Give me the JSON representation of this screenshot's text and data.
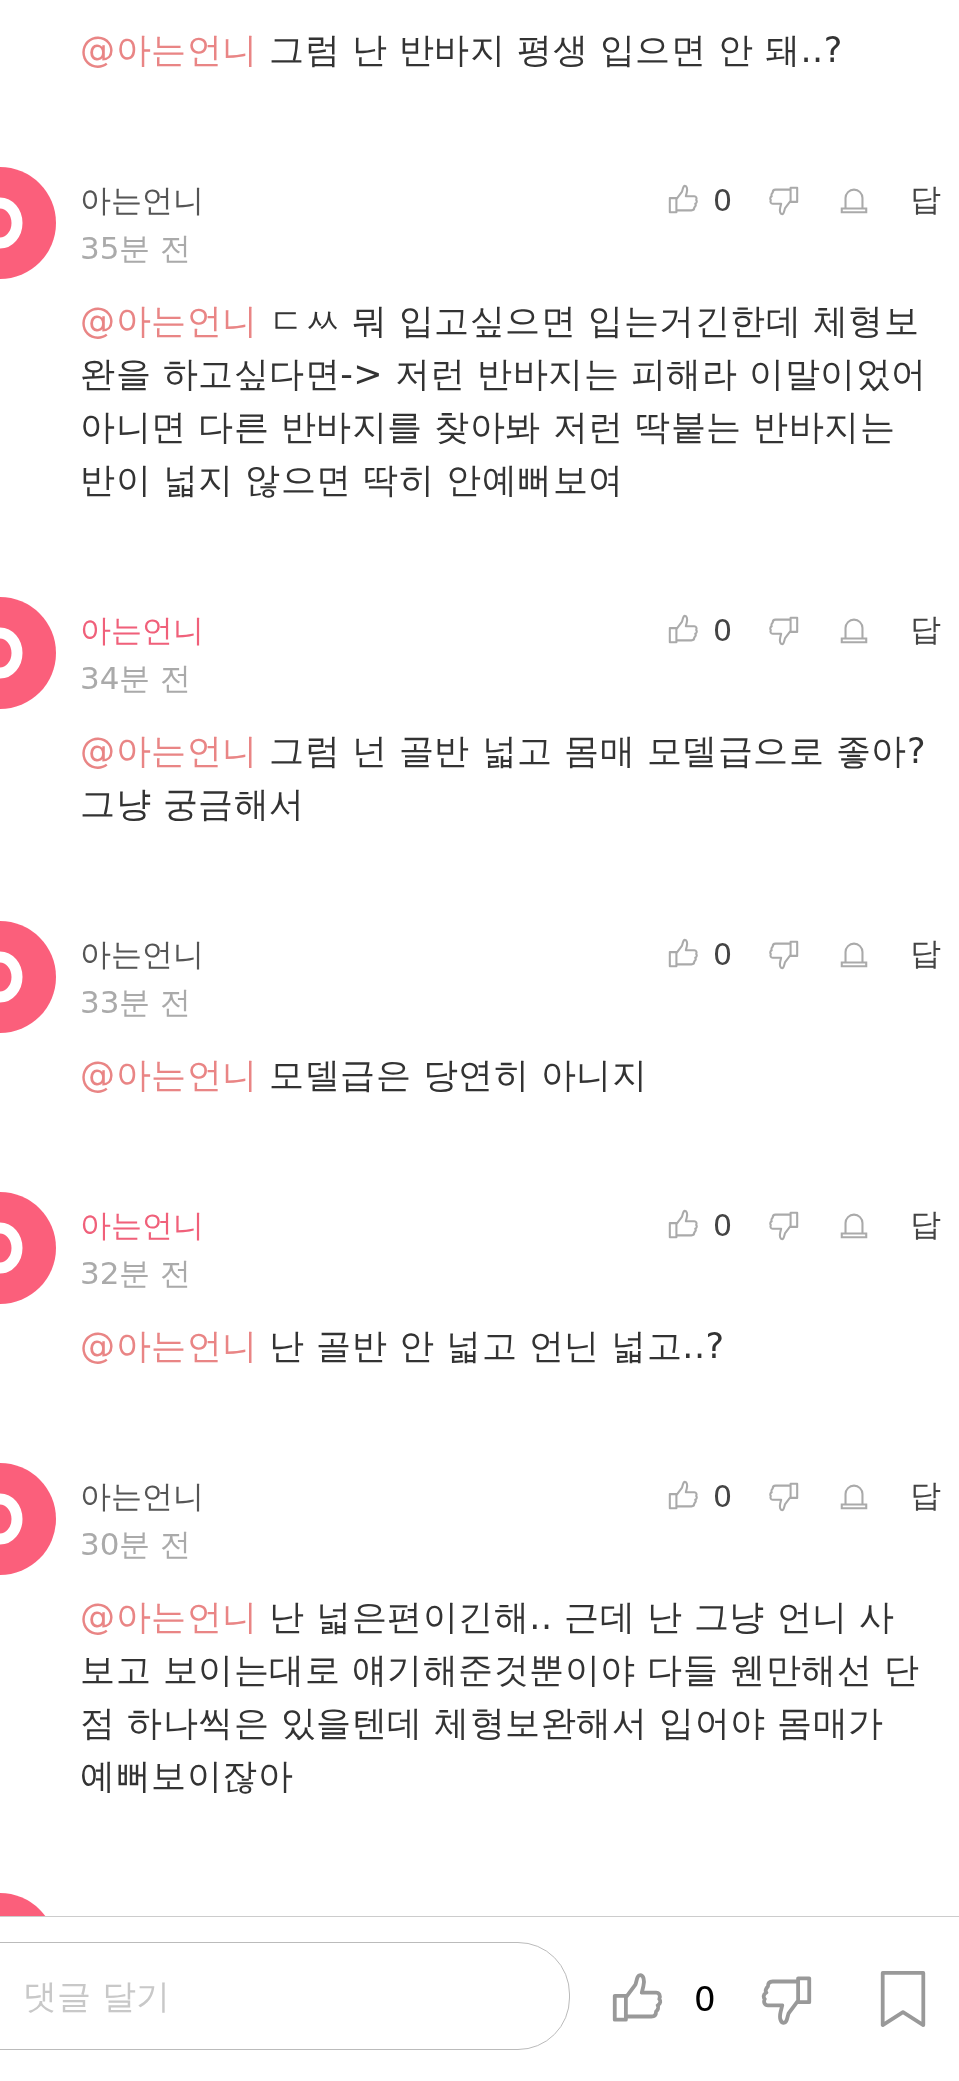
{
  "top_reply": {
    "mention": "@아는언니",
    "lines": [
      "그럼 난 반바지 평생 입으면 안 돼..?"
    ]
  },
  "comments": [
    {
      "author": "아는언니",
      "color": "#555555",
      "time": "35분 전",
      "likes": "0",
      "reply": "답",
      "mention": "@아는언니",
      "lines": [
        "ㄷㅆ 뭐 입고싶으면 입는거긴한데 체형보",
        "완을 하고싶다면-> 저런 반바지는 피해라 이말이었어",
        "아니면 다른 반바지를 찾아봐 저런 딱붙는 반바지는",
        "반이 넓지 않으면 딱히 안예뻐보여"
      ]
    },
    {
      "author": "아는언니",
      "color": "#f0607a",
      "time": "34분 전",
      "likes": "0",
      "reply": "답",
      "mention": "@아는언니",
      "lines": [
        "그럼 넌 골반 넓고 몸매 모델급으로 좋아?",
        "그냥 궁금해서"
      ]
    },
    {
      "author": "아는언니",
      "color": "#555555",
      "time": "33분 전",
      "likes": "0",
      "reply": "답",
      "mention": "@아는언니",
      "lines": [
        "모델급은 당연히 아니지"
      ]
    },
    {
      "author": "아는언니",
      "color": "#f0607a",
      "time": "32분 전",
      "likes": "0",
      "reply": "답",
      "mention": "@아는언니",
      "lines": [
        "난 골반 안 넓고 언닌 넓고..?"
      ]
    },
    {
      "author": "아는언니",
      "color": "#555555",
      "time": "30분 전",
      "likes": "0",
      "reply": "답",
      "mention": "@아는언니",
      "lines": [
        "난 넓은편이긴해.. 근데 난 그냥 언니 사",
        "보고 보이는대로 얘기해준것뿐이야 다들 웬만해선 단",
        "점 하나씩은 있을텐데 체형보완해서 입어야 몸매가",
        "예뻐보이잖아"
      ]
    }
  ],
  "bottom_bar": {
    "placeholder": "댓글 달기",
    "likes": "0"
  }
}
